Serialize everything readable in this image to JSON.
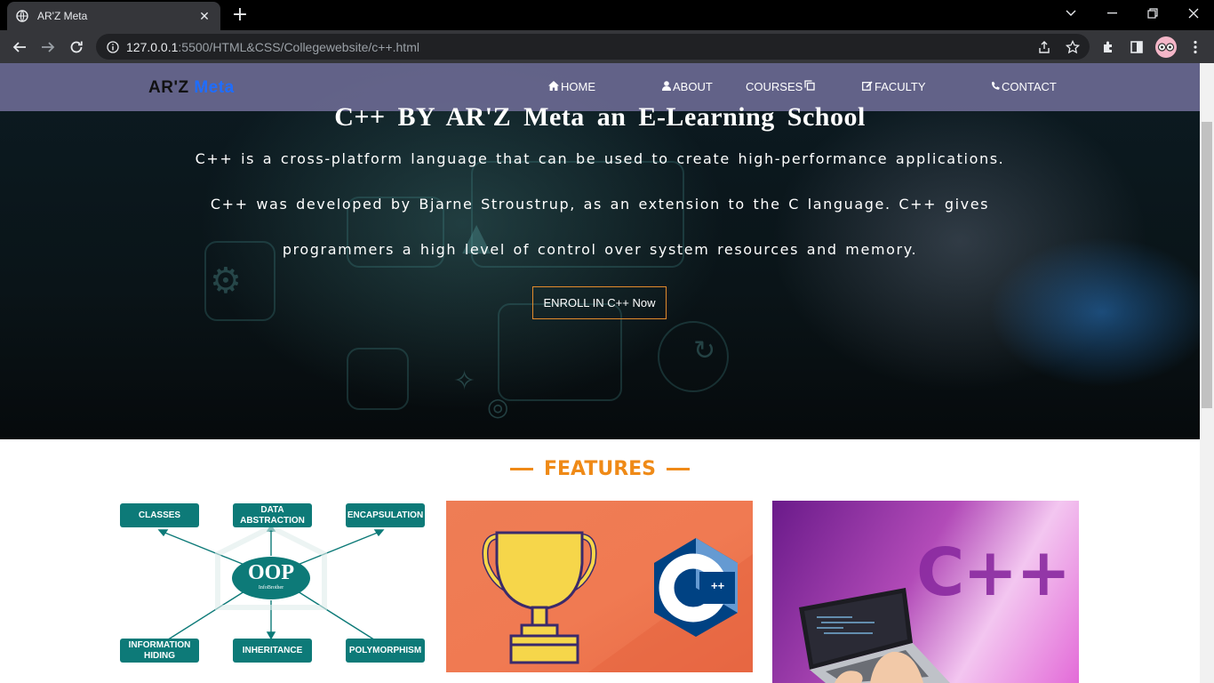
{
  "browser": {
    "tab_title": "AR'Z Meta",
    "url_host": "127.0.0.1",
    "url_path": ":5500/HTML&CSS/Collegewebsite/c++.html"
  },
  "page": {
    "brand": {
      "part1": "AR'Z",
      "part2": "Meta"
    },
    "nav": {
      "home": "HOME",
      "about": "ABOUT",
      "courses": "COURSES",
      "faculty": "FACULTY",
      "contact": "CONTACT"
    },
    "hero": {
      "title": "C++ BY AR'Z Meta an E-Learning School",
      "line1": "C++ is a cross-platform language that can be used to create high-performance applications.",
      "line2": "C++ was developed by Bjarne Stroustrup, as an extension to the C language. C++ gives",
      "line3": "programmers a high level of control over system resources and memory.",
      "button": "ENROLL IN C++ Now"
    },
    "features": {
      "title": "FEATURES",
      "oop": {
        "center": "OOP",
        "center_sub": "InfoBrother",
        "classes": "CLASSES",
        "data_abstraction_1": "DATA",
        "data_abstraction_2": "ABSTRACTION",
        "encapsulation": "ENCAPSULATION",
        "information_hiding_1": "INFORMATION",
        "information_hiding_2": "HIDING",
        "inheritance": "INHERITANCE",
        "polymorphism": "POLYMORPHISM"
      },
      "card2_logo": "C",
      "card2_logo_sup": "++",
      "card3_text": "C++"
    }
  },
  "colors": {
    "navbar": "#6e6c96",
    "brand_accent": "#1f6dff",
    "features_accent": "#ef8a17",
    "oop_teal": "#0d7a78",
    "button_border": "#e38b2c"
  }
}
